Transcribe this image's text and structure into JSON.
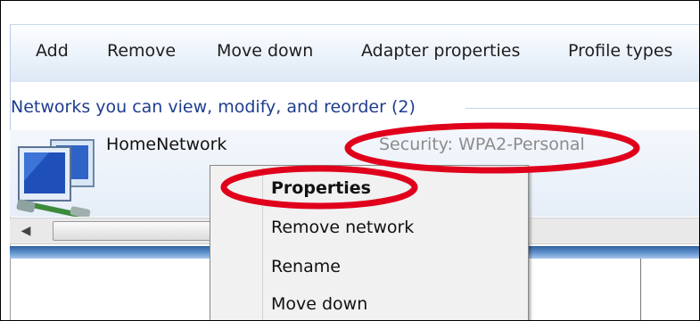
{
  "toolbar": {
    "add_label": "Add",
    "remove_label": "Remove",
    "move_down_label": "Move down",
    "adapter_properties_label": "Adapter properties",
    "profile_types_label": "Profile types"
  },
  "networks": {
    "group_header": "Networks you can view, modify, and reorder (2)",
    "items": [
      {
        "name": "HomeNetwork",
        "security": "Security:  WPA2-Personal"
      }
    ]
  },
  "context_menu": {
    "items": [
      {
        "label": "Properties",
        "bold": true
      },
      {
        "label": "Remove network"
      },
      {
        "label": "Rename"
      },
      {
        "label": "Move down"
      }
    ]
  },
  "icons": {
    "network": "network-computers-icon",
    "scroll_left": "scroll-left-arrow-icon"
  },
  "colors": {
    "annotation": "#e0001b",
    "group_header": "#1e3d8f",
    "security_text": "#8c8c8c"
  }
}
